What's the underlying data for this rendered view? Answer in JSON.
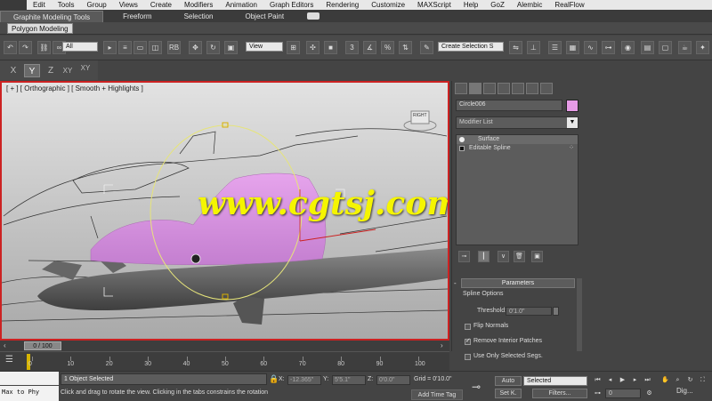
{
  "menu": [
    "Edit",
    "Tools",
    "Group",
    "Views",
    "Create",
    "Modifiers",
    "Animation",
    "Graph Editors",
    "Rendering",
    "Customize",
    "MAXScript",
    "Help",
    "GoZ",
    "Alembic",
    "RealFlow"
  ],
  "ribbon": {
    "tabs": [
      "Graphite Modeling Tools",
      "Freeform",
      "Selection",
      "Object Paint"
    ],
    "panel": "Polygon Modeling"
  },
  "toolbar": {
    "filter": "All",
    "refcoord": "View",
    "snap": "3",
    "named_selection": "Create Selection S"
  },
  "axis": {
    "buttons": [
      "X",
      "Y",
      "Z",
      "XY",
      "XY"
    ],
    "active": "Y"
  },
  "viewport": {
    "label": "[ + ] [ Orthographic ] [ Smooth + Highlights ]",
    "viewcube": "RIGHT",
    "watermark": "www.cgtsj.com"
  },
  "command_panel": {
    "object_name": "Circle006",
    "object_color": "#e69be6",
    "modifier_list": "Modifier List",
    "stack": [
      {
        "label": "Surface",
        "selected": true,
        "icon": "bulb-icon"
      },
      {
        "label": "Editable Spline",
        "selected": false,
        "icon": "box-icon"
      }
    ],
    "rollout": {
      "title": "Parameters",
      "pm": "-",
      "group": "Spline Options",
      "threshold_label": "Threshold:",
      "threshold_value": "0'1.0\"",
      "options": [
        {
          "label": "Flip Normals",
          "checked": false
        },
        {
          "label": "Remove Interior Patches",
          "checked": true
        },
        {
          "label": "Use Only Selected Segs.",
          "checked": false
        }
      ]
    }
  },
  "timeline": {
    "slider": "0 / 100",
    "ticks": [
      "0",
      "10",
      "20",
      "30",
      "40",
      "50",
      "60",
      "70",
      "80",
      "90",
      "100"
    ]
  },
  "status": {
    "maxscript": "Max to Phy",
    "selected": "1 Object Selected",
    "prompt": "Click and drag to rotate the view.  Clicking in the tabs constrains the rotation",
    "x_label": "X:",
    "x_value": "-12.365\"",
    "y_label": "Y:",
    "y_value": "5'5.1\"",
    "z_label": "Z:",
    "z_value": "0'0.0\"",
    "grid": "Grid = 0'10.0\"",
    "add_time_tag": "Add Time Tag",
    "auto": "Auto",
    "set_key": "Set K.",
    "selected_dd": "Selected",
    "filters": "Filters...",
    "frame": "0",
    "logo": "Dig..."
  }
}
